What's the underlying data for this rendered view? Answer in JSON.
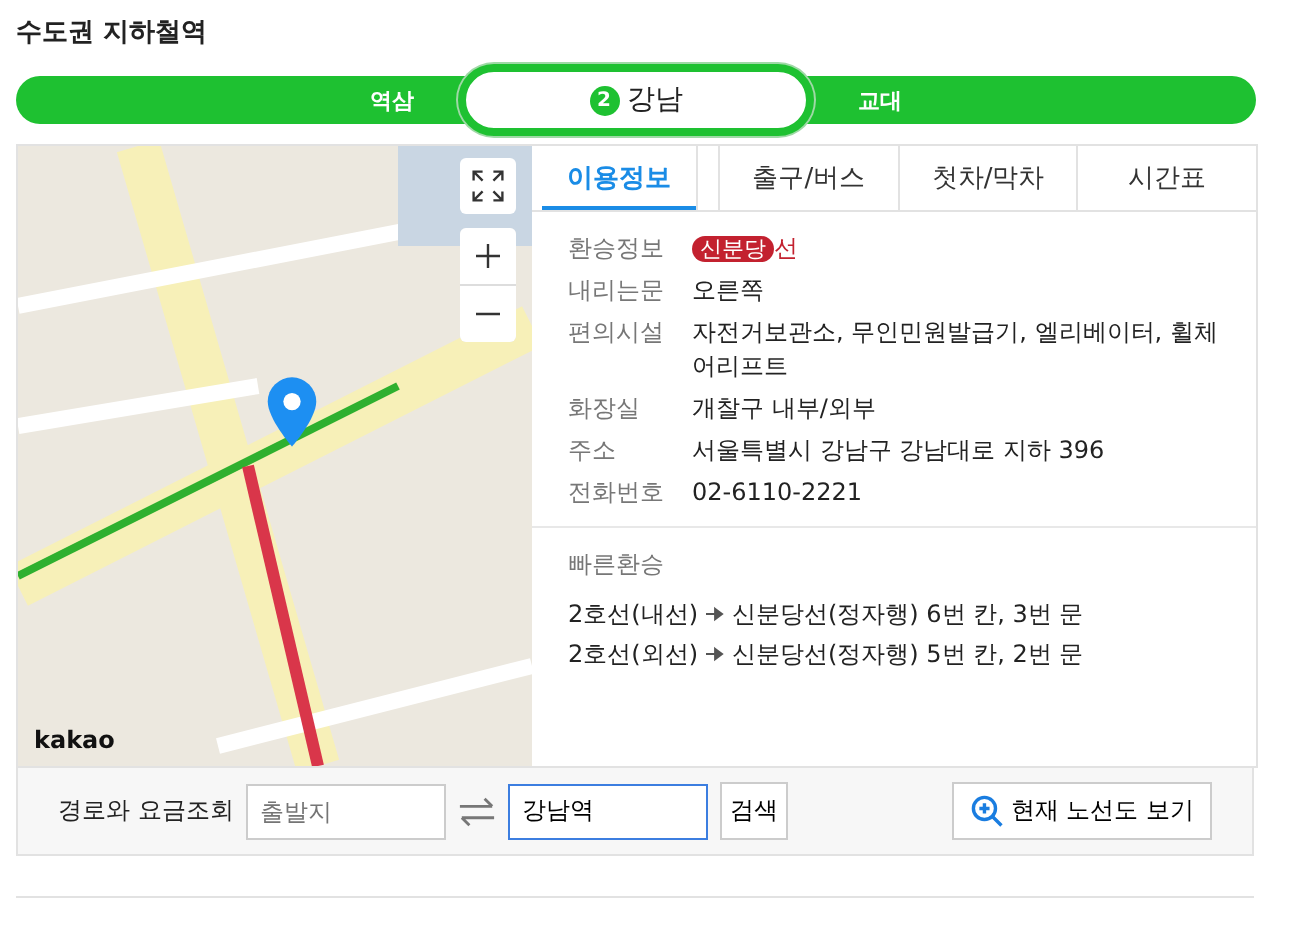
{
  "title": "수도권 지하철역",
  "line_bar": {
    "prev": "역삼",
    "current": {
      "badge": "2",
      "name": "강남",
      "color": "#1ec131"
    },
    "next": "교대"
  },
  "map": {
    "attribution": "kakao"
  },
  "tabs": [
    {
      "label": "이용정보",
      "selected": true
    },
    {
      "label": "출구/버스",
      "selected": false
    },
    {
      "label": "첫차/막차",
      "selected": false
    },
    {
      "label": "시간표",
      "selected": false
    }
  ],
  "info": [
    {
      "label": "환승정보",
      "kind": "transfer",
      "badge": "신분당",
      "suffix": "선",
      "color": "#c3212f"
    },
    {
      "label": "내리는문",
      "kind": "text",
      "value": "오른쪽"
    },
    {
      "label": "편의시설",
      "kind": "text",
      "value": "자전거보관소, 무인민원발급기, 엘리베이터, 휠체어리프트"
    },
    {
      "label": "화장실",
      "kind": "text",
      "value": "개찰구 내부/외부"
    },
    {
      "label": "주소",
      "kind": "text",
      "value": "서울특별시 강남구 강남대로 지하 396"
    },
    {
      "label": "전화번호",
      "kind": "text",
      "value": "02-6110-2221"
    }
  ],
  "quick_transfer": {
    "heading": "빠른환승",
    "rows": [
      {
        "from": "2호선(내선)",
        "to": "신분당선(정자행) 6번 칸, 3번 문"
      },
      {
        "from": "2호선(외선)",
        "to": "신분당선(정자행) 5번 칸, 2번 문"
      }
    ]
  },
  "route": {
    "label": "경로와 요금조회",
    "origin_placeholder": "출발지",
    "destination_value": "강남역",
    "search_button": "검색",
    "map_button": "현재 노선도 보기"
  }
}
